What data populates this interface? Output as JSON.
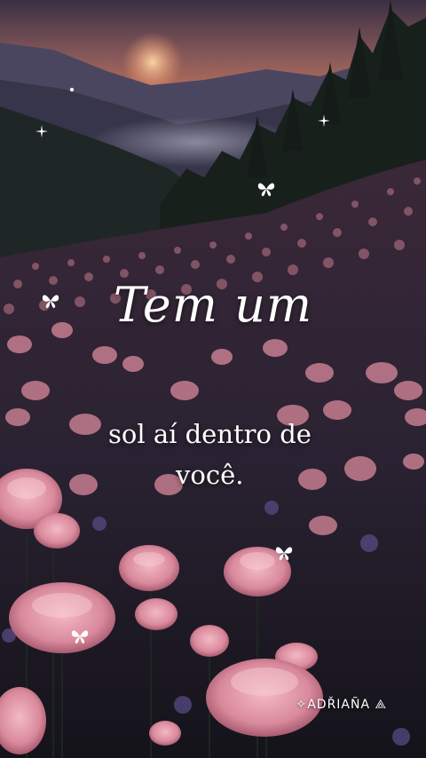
{
  "text": {
    "title": "Tem um",
    "line1": "sol aí dentro de",
    "line2": "você."
  },
  "signature": "✧ADŘIAÑA ⟁",
  "colors": {
    "sky_top": "#3a3044",
    "sunset": "#c8785a",
    "mountain": "#3d3a4e",
    "forest": "#1a1f1c",
    "flower": "#d98a9c",
    "text": "#ffffff"
  },
  "icons": [
    "butterfly-icon",
    "sparkle-icon"
  ]
}
